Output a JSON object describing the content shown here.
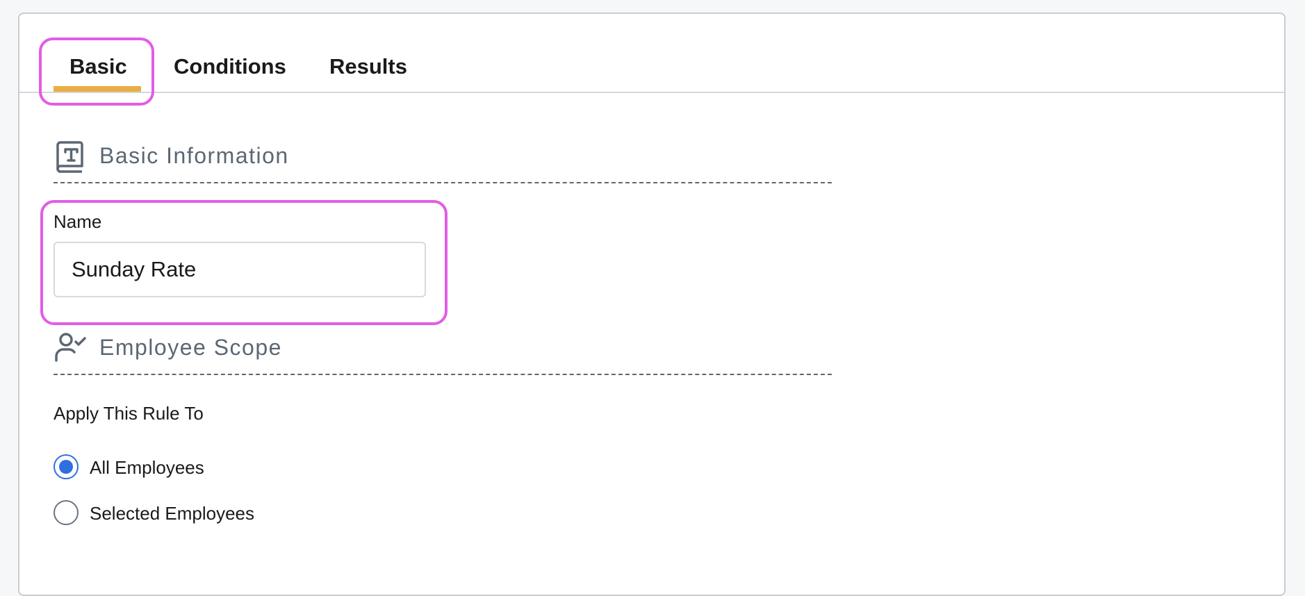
{
  "tabs": [
    {
      "label": "Basic",
      "active": true
    },
    {
      "label": "Conditions",
      "active": false
    },
    {
      "label": "Results",
      "active": false
    }
  ],
  "sections": {
    "basic_info": {
      "title": "Basic Information",
      "icon": "text-document-icon"
    },
    "employee_scope": {
      "title": "Employee Scope",
      "icon": "user-check-icon"
    }
  },
  "name_field": {
    "label": "Name",
    "value": "Sunday Rate"
  },
  "apply_rule": {
    "label": "Apply This Rule To",
    "options": [
      {
        "label": "All Employees",
        "selected": true
      },
      {
        "label": "Selected Employees",
        "selected": false
      }
    ]
  },
  "colors": {
    "active_tab_underline": "#e8ae43",
    "highlight": "#e25ce6",
    "radio_selected": "#2f6fe0",
    "section_title": "#5b6773"
  }
}
